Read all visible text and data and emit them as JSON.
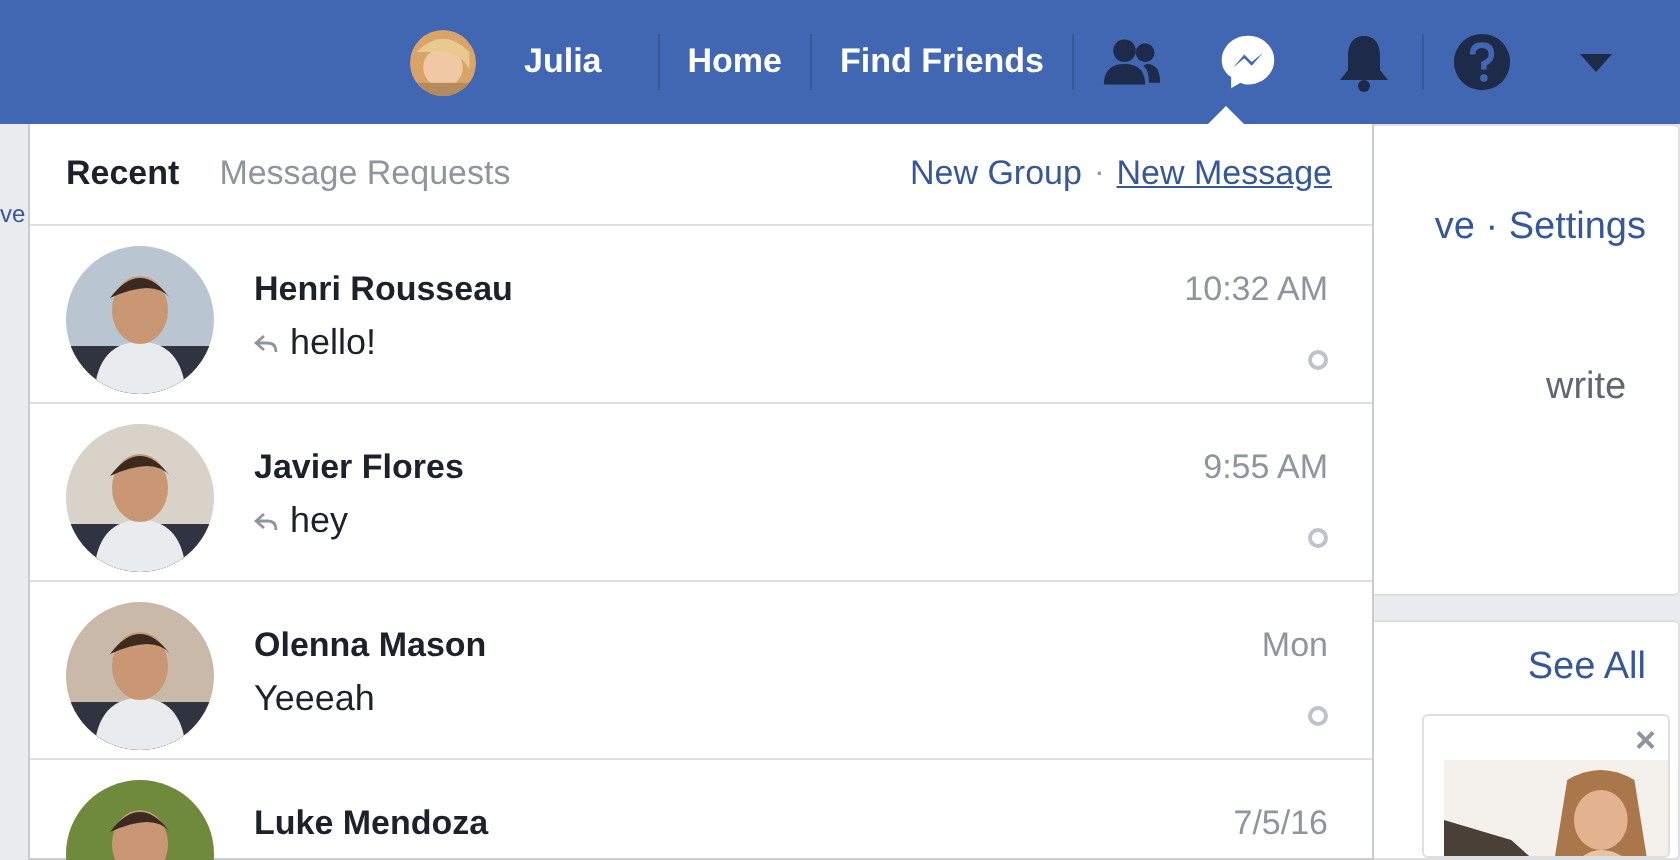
{
  "top_bar": {
    "profile_name": "Julia",
    "links": [
      "Home",
      "Find Friends"
    ],
    "icons": [
      {
        "kind": "friends",
        "selected": false
      },
      {
        "kind": "messenger",
        "selected": true
      },
      {
        "kind": "bell",
        "selected": false
      },
      {
        "kind": "help",
        "selected": false
      },
      {
        "kind": "caret",
        "selected": false
      }
    ]
  },
  "background": {
    "left_text": "ve",
    "card_text": "ve · Settings",
    "card_line": "write",
    "section_link": "See All",
    "close": "×"
  },
  "messages_menu": {
    "tabs": [
      {
        "label": "Recent",
        "selected": true
      },
      {
        "label": "Message Requests",
        "selected": false
      }
    ],
    "actions": [
      "New Group",
      "New Message"
    ],
    "separator": "·",
    "conversations": [
      {
        "name": "Henri Rousseau",
        "snippet": "hello!",
        "replied": true,
        "time": "10:32 AM"
      },
      {
        "name": "Javier Flores",
        "snippet": "hey",
        "replied": true,
        "time": "9:55 AM"
      },
      {
        "name": "Olenna Mason",
        "snippet": "Yeeeah",
        "replied": false,
        "time": "Mon"
      },
      {
        "name": "Luke Mendoza",
        "time": "7/5/16"
      }
    ]
  }
}
